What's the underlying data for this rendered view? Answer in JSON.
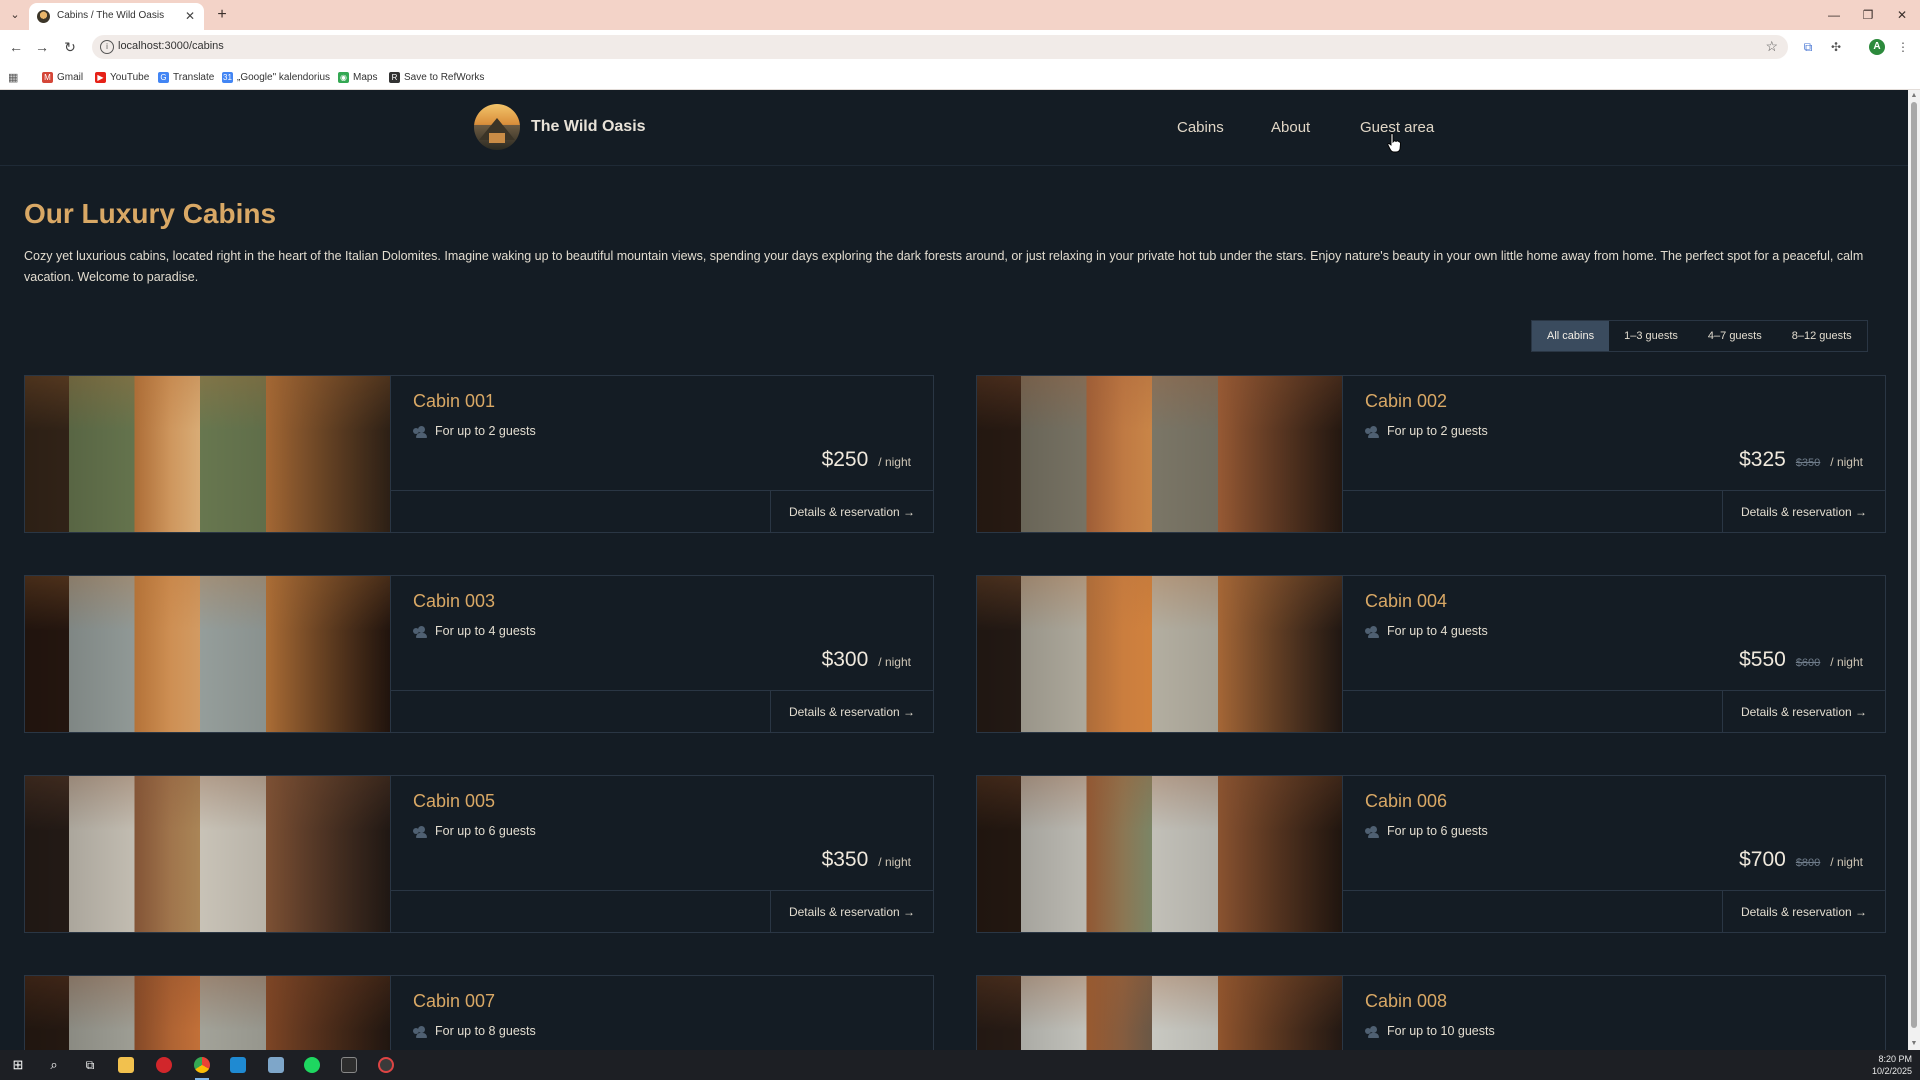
{
  "browser": {
    "tab_title": "Cabins / The Wild Oasis",
    "url": "localhost:3000/cabins",
    "bookmarks": [
      {
        "label": "Gmail",
        "color": "#d44638",
        "glyph": "M"
      },
      {
        "label": "YouTube",
        "color": "#e62117",
        "glyph": "▶"
      },
      {
        "label": "Translate",
        "color": "#4285f4",
        "glyph": "G"
      },
      {
        "label": "„Google\" kalendorius",
        "color": "#4285f4",
        "glyph": "31"
      },
      {
        "label": "Maps",
        "color": "#34a853",
        "glyph": "◉"
      },
      {
        "label": "Save to RefWorks",
        "color": "#333333",
        "glyph": "R"
      }
    ]
  },
  "header": {
    "brand": "The Wild Oasis",
    "nav": [
      "Cabins",
      "About",
      "Guest area"
    ]
  },
  "main": {
    "title": "Our Luxury Cabins",
    "intro": "Cozy yet luxurious cabins, located right in the heart of the Italian Dolomites. Imagine waking up to beautiful mountain views, spending your days exploring the dark forests around, or just relaxing in your private hot tub under the stars. Enjoy nature's beauty in your own little home away from home. The perfect spot for a peaceful, calm vacation. Welcome to paradise.",
    "filters": [
      "All cabins",
      "1–3 guests",
      "4–7 guests",
      "8–12 guests"
    ],
    "active_filter": "All cabins"
  },
  "cabins": [
    {
      "name": "Cabin 001",
      "guests": "For up to 2 guests",
      "price": "$250",
      "old_price": "",
      "per_night": "/ night",
      "cta": "Details & reservation →",
      "palette": [
        "#3b2a1c",
        "#b8743a",
        "#6b7b52",
        "#e0b27a"
      ]
    },
    {
      "name": "Cabin 002",
      "guests": "For up to 2 guests",
      "price": "$325",
      "old_price": "$350",
      "per_night": "/ night",
      "cta": "Details & reservation →",
      "palette": [
        "#2f1f16",
        "#a9643a",
        "#7f7a6a",
        "#d08a4a"
      ]
    },
    {
      "name": "Cabin 003",
      "guests": "For up to 4 guests",
      "price": "$300",
      "old_price": "",
      "per_night": "/ night",
      "cta": "Details & reservation →",
      "palette": [
        "#2b1a12",
        "#c07a3c",
        "#9aa3a0",
        "#d9a066"
      ]
    },
    {
      "name": "Cabin 004",
      "guests": "For up to 4 guests",
      "price": "$550",
      "old_price": "$600",
      "per_night": "/ night",
      "cta": "Details & reservation →",
      "palette": [
        "#2a1e18",
        "#b9733d",
        "#b9b4a6",
        "#d8863f"
      ]
    },
    {
      "name": "Cabin 005",
      "guests": "For up to 6 guests",
      "price": "$350",
      "old_price": "",
      "per_night": "/ night",
      "cta": "Details & reservation →",
      "palette": [
        "#2a1f1a",
        "#8c5a3a",
        "#cfc9bd",
        "#b08a5a"
      ]
    },
    {
      "name": "Cabin 006",
      "guests": "For up to 6 guests",
      "price": "$700",
      "old_price": "$800",
      "per_night": "/ night",
      "cta": "Details & reservation →",
      "palette": [
        "#2a1c14",
        "#9b5d36",
        "#c8c6be",
        "#7f8a6a"
      ]
    },
    {
      "name": "Cabin 007",
      "guests": "For up to 8 guests",
      "price": "",
      "old_price": "",
      "per_night": "",
      "cta": "",
      "palette": [
        "#2b1d15",
        "#8d4e2a",
        "#a8a89e",
        "#c9743a"
      ]
    },
    {
      "name": "Cabin 008",
      "guests": "For up to 10 guests",
      "price": "",
      "old_price": "",
      "per_night": "",
      "cta": "",
      "palette": [
        "#2e2019",
        "#a25f33",
        "#cfcfc8",
        "#6d5a48"
      ]
    }
  ],
  "taskbar": {
    "time": "8:20 PM",
    "date": "10/2/2025"
  }
}
